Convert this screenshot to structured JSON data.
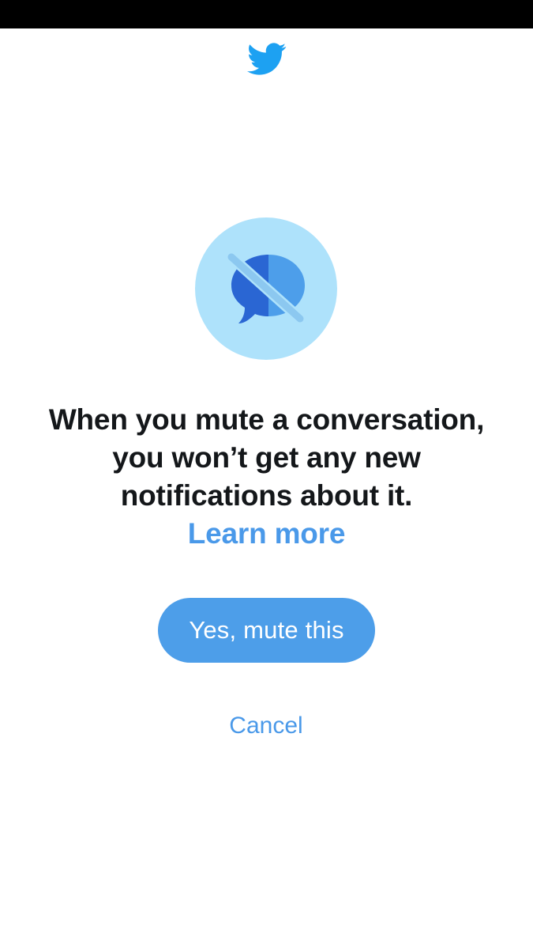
{
  "colors": {
    "brand_blue": "#1da1f2",
    "link_blue": "#4a99e9",
    "button_blue": "#4d9ee9",
    "circle_bg": "#aee2fb",
    "text_dark": "#14171a"
  },
  "header": {
    "logo_icon": "twitter-bird-icon"
  },
  "illustration": {
    "icon": "muted-conversation-icon"
  },
  "message": {
    "line1": "When you mute a conversation,",
    "line2": "you won’t get any new",
    "line3": "notifications about it.",
    "learn_more": "Learn more"
  },
  "actions": {
    "confirm_label": "Yes, mute this",
    "cancel_label": "Cancel"
  }
}
